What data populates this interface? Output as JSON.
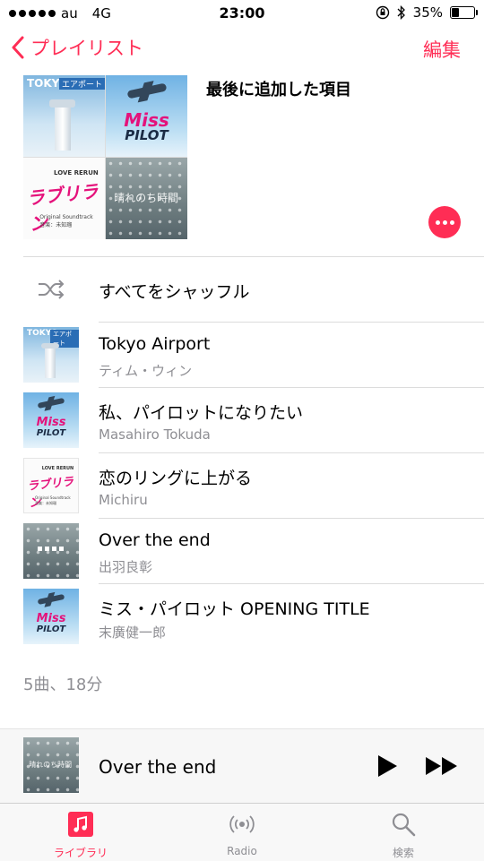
{
  "status_bar": {
    "carrier": "au",
    "network": "4G",
    "time": "23:00",
    "battery": "35%",
    "battery_level": 0.35
  },
  "nav": {
    "back_label": "プレイリスト",
    "edit_label": "編集"
  },
  "playlist": {
    "title": "最後に追加した項目",
    "artwork": {
      "tokyo_title": "TOKYO",
      "tokyo_tag": "エアポート",
      "miss_word": "Miss",
      "pilot_word": "PILOT",
      "love_small": "LOVE RERUN",
      "love_word": "ラブリラン",
      "love_caption_1": "Original Soundtrack",
      "love_caption_2": "音楽：未知瑠",
      "rain_title": "晴れのち時間"
    }
  },
  "shuffle_label": "すべてをシャッフル",
  "songs": [
    {
      "title": "Tokyo Airport",
      "artist": "ティム・ウィン"
    },
    {
      "title": "私、パイロットになりたい",
      "artist": "Masahiro Tokuda"
    },
    {
      "title": "恋のリングに上がる",
      "artist": "Michiru"
    },
    {
      "title": "Over the end",
      "artist": "出羽良彰"
    },
    {
      "title": "ミス・パイロット OPENING TITLE",
      "artist": "末廣健一郎"
    }
  ],
  "summary": "5曲、18分",
  "now_playing": {
    "title": "Over the end"
  },
  "tabs": [
    {
      "label": "ライブラリ",
      "icon": "music-note-icon",
      "active": true
    },
    {
      "label": "Radio",
      "icon": "radio-icon",
      "active": false
    },
    {
      "label": "検索",
      "icon": "search-icon",
      "active": false
    }
  ],
  "colors": {
    "accent": "#ff2d55",
    "secondary_text": "#8e8e93"
  }
}
